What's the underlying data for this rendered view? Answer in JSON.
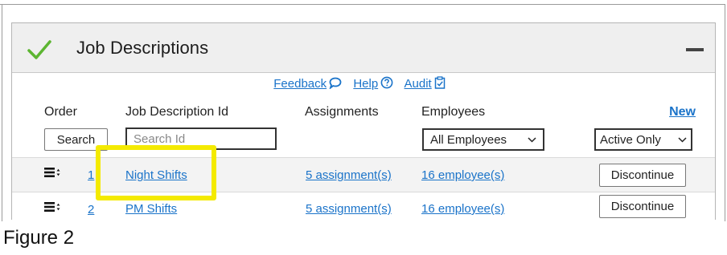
{
  "panel": {
    "title": "Job Descriptions",
    "accent_color": "#5cb531"
  },
  "links": {
    "feedback": "Feedback",
    "help": "Help",
    "audit": "Audit"
  },
  "columns": {
    "order": "Order",
    "job_id": "Job Description Id",
    "assignments": "Assignments",
    "employees": "Employees",
    "new": "New"
  },
  "filters": {
    "search_button": "Search",
    "search_placeholder": "Search Id",
    "employees_select": "All Employees",
    "status_select": "Active Only"
  },
  "rows": [
    {
      "order": "1",
      "name": "Night Shifts",
      "assignments": "5 assignment(s)",
      "employees": "16 employee(s)",
      "action": "Discontinue"
    },
    {
      "order": "2",
      "name": "PM Shifts",
      "assignments": "5 assignment(s)",
      "employees": "16 employee(s)",
      "action": "Discontinue"
    }
  ],
  "highlight_color": "#f4ea00",
  "caption": "Figure 2"
}
